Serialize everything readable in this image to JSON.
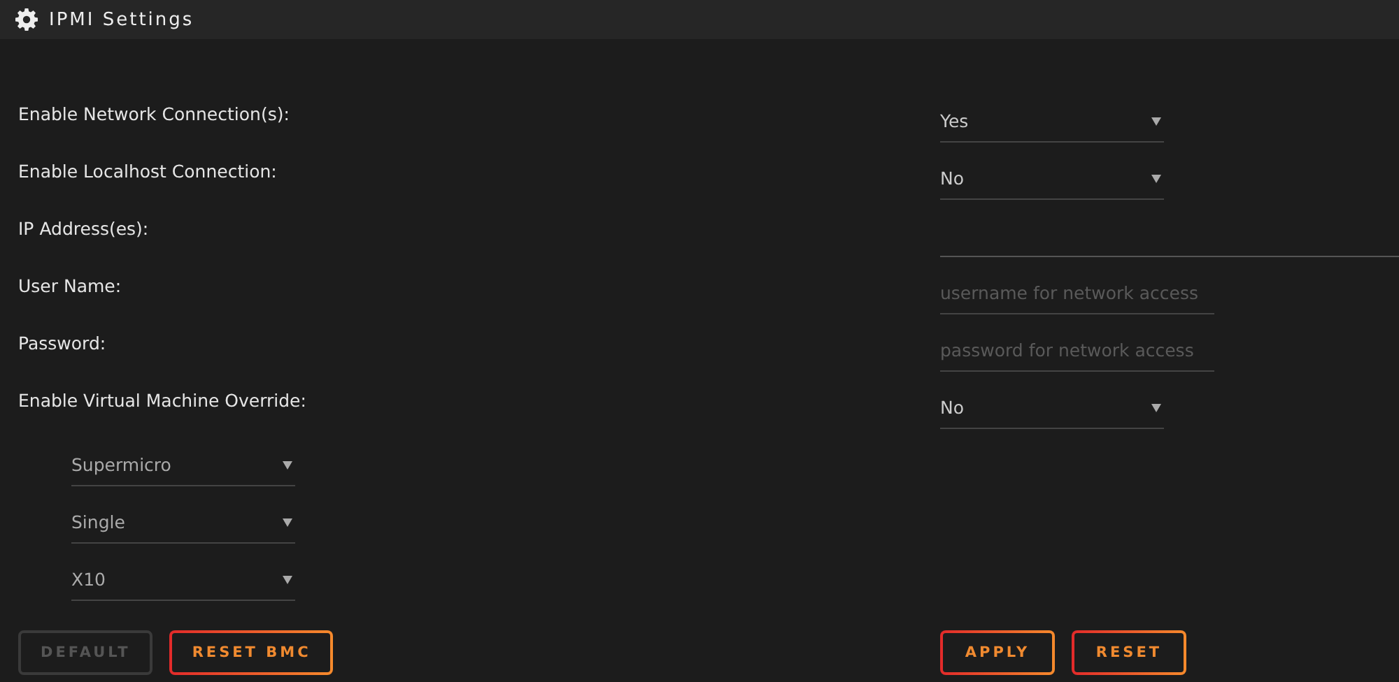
{
  "header": {
    "title": "IPMI Settings"
  },
  "fields": [
    {
      "label": "Enable Network Connection(s):",
      "kind": "select",
      "value": "Yes"
    },
    {
      "label": "Enable Localhost Connection:",
      "kind": "select",
      "value": "No"
    },
    {
      "label": "IP Address(es):",
      "kind": "wide"
    },
    {
      "label": "User Name:",
      "kind": "input",
      "placeholder": "username for network access"
    },
    {
      "label": "Password:",
      "kind": "input",
      "placeholder": "password for network access"
    },
    {
      "label": "Enable Virtual Machine Override:",
      "kind": "select",
      "value": "No"
    }
  ],
  "sub_selects": [
    {
      "value": "Supermicro"
    },
    {
      "value": "Single"
    },
    {
      "value": "X10"
    }
  ],
  "left_buttons": [
    {
      "label": "DEFAULT",
      "disabled": true
    },
    {
      "label": "RESET BMC",
      "disabled": false
    }
  ],
  "right_buttons": [
    {
      "label": "APPLY",
      "disabled": false
    },
    {
      "label": "RESET",
      "disabled": false
    }
  ]
}
